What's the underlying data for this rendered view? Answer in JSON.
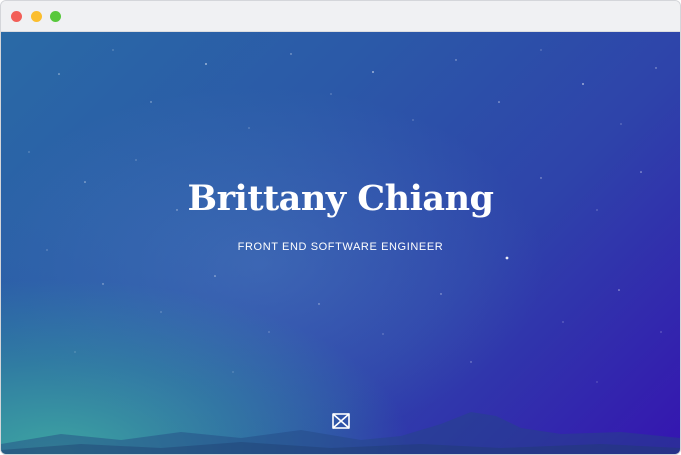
{
  "window": {
    "controls": [
      "close",
      "minimize",
      "maximize"
    ]
  },
  "hero": {
    "title": "Brittany Chiang",
    "subtitle": "FRONT END SOFTWARE ENGINEER",
    "logo_icon": "bowtie-logo-icon"
  },
  "colors": {
    "gradient_start": "#2a6aa6",
    "gradient_end": "#3515b0",
    "teal_glow": "#40b2a0",
    "text": "#ffffff",
    "close": "#f25f58",
    "minimize": "#fbbe2e",
    "maximize": "#58c83c"
  }
}
